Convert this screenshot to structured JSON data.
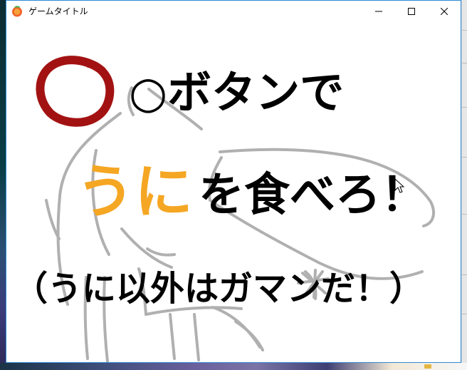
{
  "window": {
    "title": "ゲームタイトル",
    "controls": {
      "minimize": "minimize",
      "maximize": "maximize",
      "close": "close"
    }
  },
  "canvas": {
    "line1": "○ボタンで",
    "line2_highlight": "うに",
    "line2_rest": "を食べろ！",
    "line3": "（うに以外はガマンだ！）"
  },
  "colors": {
    "title_border": "#2e8bd6",
    "circle": "#a31212",
    "highlight": "#f5a623",
    "ink": "#000000",
    "sketch": "#b0b0b0"
  },
  "icons": {
    "app": "game-icon",
    "minimize": "minimize-icon",
    "maximize": "maximize-icon",
    "close": "close-icon",
    "cursor": "mouse-cursor-icon"
  }
}
